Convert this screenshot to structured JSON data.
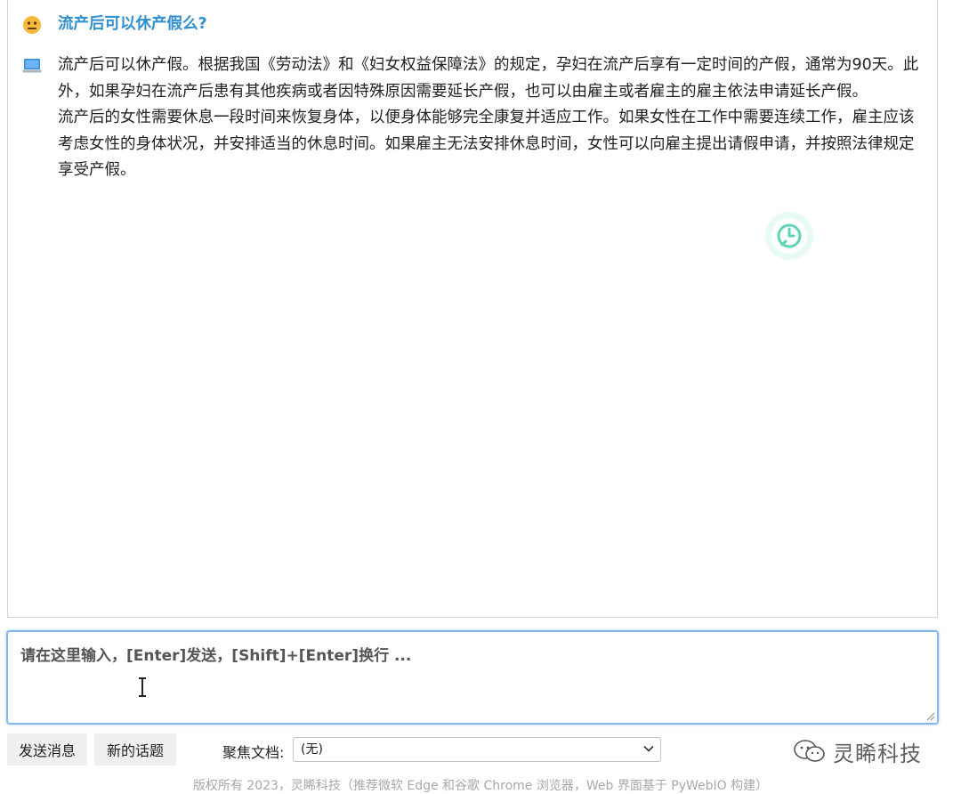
{
  "conversation": {
    "question": "流产后可以休产假么?",
    "answer_paragraphs": [
      "流产后可以休产假。根据我国《劳动法》和《妇女权益保障法》的规定，孕妇在流产后享有一定时间的产假，通常为90天。此外，如果孕妇在流产后患有其他疾病或者因特殊原因需要延长产假，也可以由雇主或者雇主的雇主依法申请延长产假。",
      "流产后的女性需要休息一段时间来恢复身体，以便身体能够完全康复并适应工作。如果女性在工作中需要连续工作，雇主应该考虑女性的身体状况，并安排适当的休息时间。如果雇主无法安排休息时间，女性可以向雇主提出请假申请，并按照法律规定享受产假。"
    ],
    "user_avatar_icon": "smiley-face-icon",
    "bot_avatar_icon": "laptop-icon"
  },
  "input": {
    "placeholder": "请在这里输入，[Enter]发送，[Shift]+[Enter]换行 ...",
    "value": ""
  },
  "controls": {
    "send_label": "发送消息",
    "new_topic_label": "新的话题",
    "focus_doc_label": "聚焦文档:",
    "focus_doc_selected": "(无)"
  },
  "watermark": {
    "text": "灵睎科技"
  },
  "footer": {
    "text": "版权所有 2023，灵睎科技（推荐微软 Edge 和谷歌 Chrome 浏览器，Web 界面基于 PyWebIO 构建）"
  },
  "colors": {
    "question": "#2f8fcf",
    "input_border": "#84b7ee",
    "button_bg": "#efefef",
    "footer_text": "#a8a8a8"
  }
}
